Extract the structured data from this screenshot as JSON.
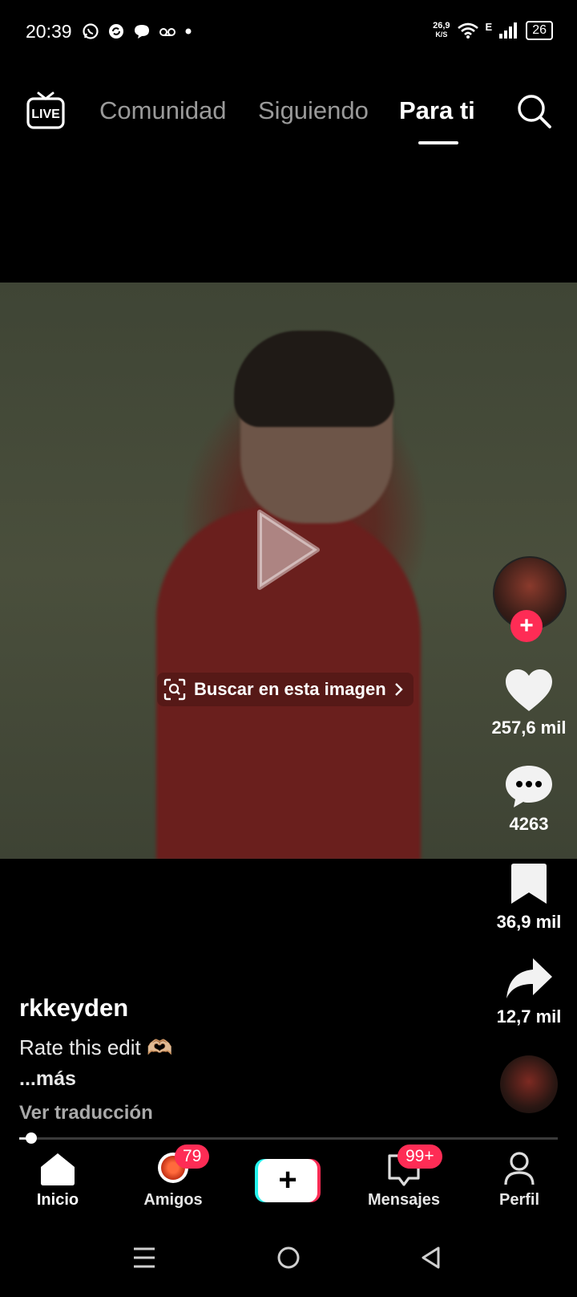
{
  "status_bar": {
    "time": "20:39",
    "net_speed_value": "26,9",
    "net_speed_unit": "K/S",
    "network_type": "E",
    "battery": "26"
  },
  "top_nav": {
    "tabs": [
      {
        "label": "Comunidad",
        "active": false
      },
      {
        "label": "Siguiendo",
        "active": false
      },
      {
        "label": "Para ti",
        "active": true
      }
    ]
  },
  "video": {
    "image_search_label": "Buscar en esta imagen"
  },
  "right_rail": {
    "likes": "257,6 mil",
    "comments": "4263",
    "saves": "36,9 mil",
    "shares": "12,7 mil"
  },
  "post": {
    "username": "rkkeyden",
    "caption": "Rate this edit 🫶🏼",
    "more_label": "...más",
    "translate_label": "Ver traducción",
    "progress": 0.02
  },
  "bottom_nav": {
    "items": [
      {
        "label": "Inicio",
        "icon": "home-icon"
      },
      {
        "label": "Amigos",
        "icon": "friends-icon",
        "badge": "79"
      },
      {
        "label": "Mensajes",
        "icon": "inbox-icon",
        "badge": "99+"
      },
      {
        "label": "Perfil",
        "icon": "profile-icon"
      }
    ]
  },
  "colors": {
    "accent_red": "#fe2c55",
    "accent_cyan": "#25f4ee",
    "inactive_tab": "#9a9a9a"
  }
}
